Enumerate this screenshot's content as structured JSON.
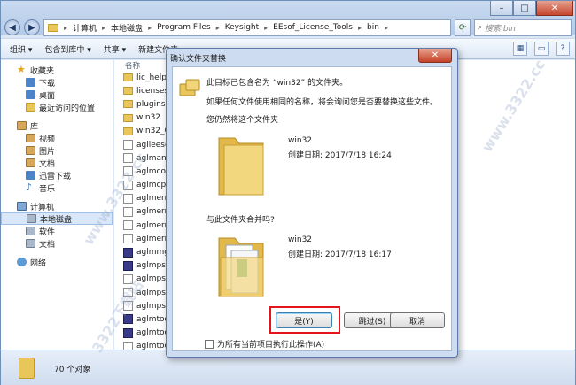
{
  "explorer": {
    "breadcrumb": [
      "计算机",
      "本地磁盘",
      "Program Files",
      "Keysight",
      "EEsof_License_Tools",
      "bin"
    ],
    "search_placeholder": "搜索 bin",
    "toolbar": {
      "organize": "组织 ▾",
      "include_in_library": "包含到库中 ▾",
      "share": "共享 ▾",
      "new_folder": "新建文件夹"
    },
    "nav": [
      {
        "label": "收藏夹",
        "icon": "star-icon",
        "group": true
      },
      {
        "label": "下载",
        "icon": "download-icon"
      },
      {
        "label": "桌面",
        "icon": "desktop-icon"
      },
      {
        "label": "最近访问的位置",
        "icon": "recent-icon"
      },
      {
        "label": "库",
        "icon": "library-icon",
        "group": true
      },
      {
        "label": "视频",
        "icon": "video-icon"
      },
      {
        "label": "图片",
        "icon": "picture-icon"
      },
      {
        "label": "文档",
        "icon": "document-icon"
      },
      {
        "label": "迅雷下载",
        "icon": "thunder-download-icon"
      },
      {
        "label": "音乐",
        "icon": "music-icon"
      },
      {
        "label": "计算机",
        "icon": "computer-icon",
        "group": true
      },
      {
        "label": "本地磁盘",
        "icon": "drive-icon",
        "selected": true
      },
      {
        "label": "软件",
        "icon": "drive-icon"
      },
      {
        "label": "文档",
        "icon": "drive-icon"
      },
      {
        "label": "网络",
        "icon": "network-icon",
        "group": true
      }
    ],
    "column_header": "名称",
    "files": [
      {
        "name": "lic_help",
        "type": "folder"
      },
      {
        "name": "licenses",
        "type": "folder"
      },
      {
        "name": "plugins",
        "type": "folder"
      },
      {
        "name": "win32",
        "type": "folder"
      },
      {
        "name": "win32_64",
        "type": "folder"
      },
      {
        "name": "agileeso",
        "type": "doc"
      },
      {
        "name": "aglmana",
        "type": "doc"
      },
      {
        "name": "aglmcon",
        "type": "doc"
      },
      {
        "name": "aglmcpu",
        "type": "doc"
      },
      {
        "name": "aglmerr",
        "type": "doc"
      },
      {
        "name": "aglmerr",
        "type": "doc"
      },
      {
        "name": "aglmerr",
        "type": "doc"
      },
      {
        "name": "aglmerr",
        "type": "doc"
      },
      {
        "name": "aglmmgr",
        "type": "exe"
      },
      {
        "name": "aglmpse",
        "type": "exe"
      },
      {
        "name": "aglmpse",
        "type": "doc"
      },
      {
        "name": "aglmpse",
        "type": "doc"
      },
      {
        "name": "aglmpse",
        "type": "doc"
      },
      {
        "name": "aglmtoo",
        "type": "exe"
      },
      {
        "name": "aglmtoo",
        "type": "exe"
      },
      {
        "name": "aglmtoo",
        "type": "doc"
      }
    ],
    "status": "70 个对象"
  },
  "dialog": {
    "title": "确认文件夹替换",
    "close_glyph": "✕",
    "line1": "此目标已包含名为 “win32” 的文件夹。",
    "line2": "如果任何文件使用相同的名称，将会询问您是否要替换这些文件。",
    "line3": "您仍然将这个文件夹",
    "existing": {
      "name": "win32",
      "date": "创建日期: 2017/7/18 16:24"
    },
    "merge_question": "与此文件夹合并吗?",
    "incoming": {
      "name": "win32",
      "date": "创建日期: 2017/7/18 16:17"
    },
    "yes_button": "是(Y)",
    "skip_button": "跳过(S)",
    "cancel_button": "取消",
    "apply_all": "为所有当前项目执行此操作(A)"
  },
  "watermarks": [
    "www.3322.cc",
    "3322下载站",
    "www.3322.cc",
    "3322下载站",
    "www.3322.cc"
  ],
  "colors": {
    "highlight": "#e5141a",
    "folder": "#e9c65a",
    "window_frame": "#cddcf0"
  }
}
